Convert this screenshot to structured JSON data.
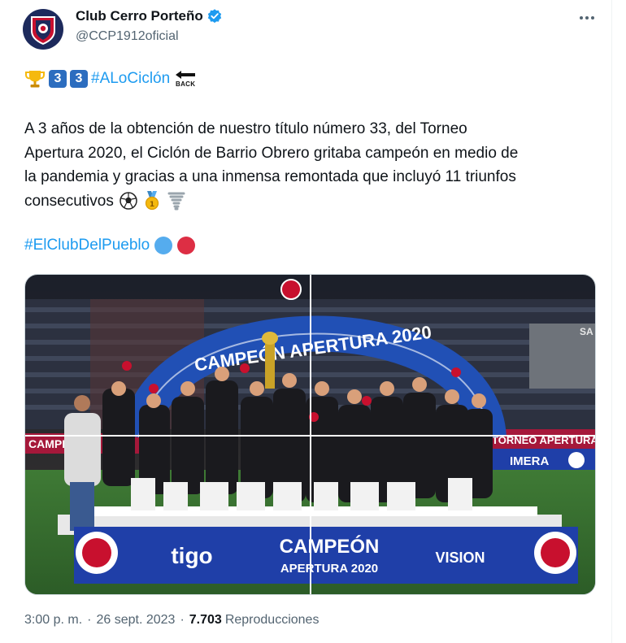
{
  "author": {
    "display_name": "Club Cerro Porteño",
    "handle": "@CCP1912oficial",
    "verified_color": "#1d9bf0"
  },
  "tweet": {
    "emoji_keycaps": [
      "3",
      "3"
    ],
    "hashtag_primary": "#ALoCiclón",
    "back_label": "BACK",
    "body_lines": [
      "A 3 años de la obtención de nuestro título número 33, del Torneo",
      "Apertura 2020, el Ciclón de Barrio Obrero gritaba campeón en medio de",
      "la pandemia y gracias a una inmensa remontada que incluyó 11 triunfos",
      "consecutivos"
    ],
    "hashtag_secondary": "#ElClubDelPueblo",
    "circle_colors": [
      "#55acee",
      "#dd2e44"
    ]
  },
  "photo": {
    "arch_text": "CAMPEÓN APERTURA 2020",
    "board_left": "tigo",
    "board_center_line1": "CAMPEÓN",
    "board_center_line2": "APERTURA 2020",
    "board_right": "VISION",
    "side_banner_left": "CAMPEÓN",
    "side_banner_right": "TORNEO APERTURA",
    "side_banner_right2": "IMERA",
    "stand_letters": "SA"
  },
  "footer": {
    "time": "3:00 p. m.",
    "date": "26 sept. 2023",
    "views_count": "7.703",
    "views_label": "Reproducciones",
    "separator": "·"
  }
}
